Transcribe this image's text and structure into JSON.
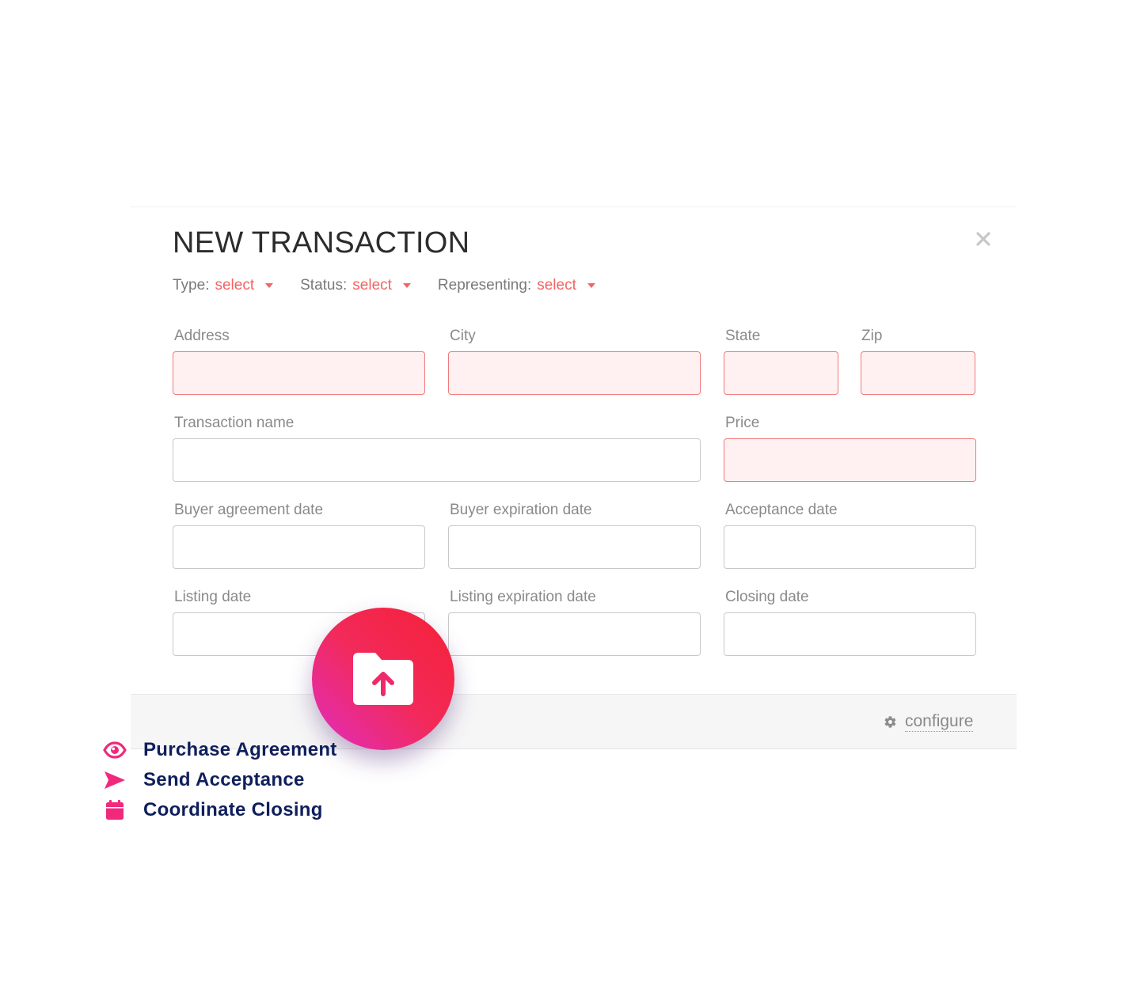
{
  "modal": {
    "title": "NEW TRANSACTION",
    "close_icon": "close-icon"
  },
  "selectors": [
    {
      "label": "Type:",
      "value": "select"
    },
    {
      "label": "Status:",
      "value": "select"
    },
    {
      "label": "Representing:",
      "value": "select"
    }
  ],
  "fields": {
    "address": {
      "label": "Address",
      "value": "",
      "invalid": true
    },
    "city": {
      "label": "City",
      "value": "",
      "invalid": true
    },
    "state": {
      "label": "State",
      "value": "",
      "invalid": true
    },
    "zip": {
      "label": "Zip",
      "value": "",
      "invalid": true
    },
    "transaction_name": {
      "label": "Transaction name",
      "value": "",
      "invalid": false
    },
    "price": {
      "label": "Price",
      "value": "",
      "invalid": true
    },
    "buyer_agreement_date": {
      "label": "Buyer agreement date",
      "value": "",
      "invalid": false
    },
    "buyer_expiration_date": {
      "label": "Buyer expiration date",
      "value": "",
      "invalid": false
    },
    "acceptance_date": {
      "label": "Acceptance date",
      "value": "",
      "invalid": false
    },
    "listing_date": {
      "label": "Listing date",
      "value": "",
      "invalid": false
    },
    "listing_expiration_date": {
      "label": "Listing expiration date",
      "value": "",
      "invalid": false
    },
    "closing_date": {
      "label": "Closing date",
      "value": "",
      "invalid": false
    }
  },
  "footer": {
    "configure_label": "configure",
    "configure_icon": "gear-icon"
  },
  "upload": {
    "icon": "folder-upload-icon"
  },
  "features": [
    {
      "icon": "eye-icon",
      "label": "Purchase Agreement"
    },
    {
      "icon": "send-icon",
      "label": "Send Acceptance"
    },
    {
      "icon": "calendar-icon",
      "label": "Coordinate Closing"
    }
  ],
  "colors": {
    "accent_red": "#f26464",
    "invalid_bg": "#fff1f1",
    "brand_pink": "#f0297c",
    "feature_text": "#0f1f5c",
    "gradient_start": "#f52036",
    "gradient_end": "#e02dc0"
  }
}
